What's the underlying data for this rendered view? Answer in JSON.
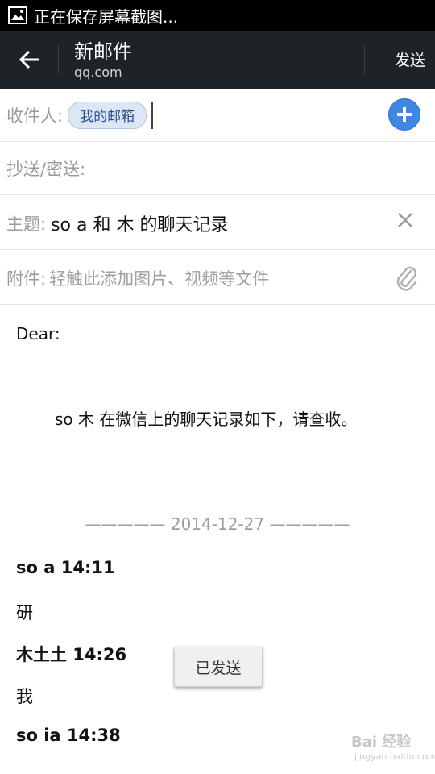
{
  "status_bar": {
    "notification_text": "正在保存屏幕截图..."
  },
  "action_bar": {
    "title": "新邮件",
    "account_email": "qq.com",
    "send_label": "发送"
  },
  "compose": {
    "to_label": "收件人:",
    "to_chip": "我的邮箱",
    "cc_label": "抄送/密送:",
    "subject_label": "主题:",
    "subject_value": "so  a 和 木 的聊天记录",
    "attachment_label": "附件:",
    "attachment_placeholder": "轻触此添加图片、视频等文件"
  },
  "body": {
    "greeting": "Dear:",
    "intro": "so  木 在微信上的聊天记录如下，请查收。",
    "divider": "—————  2014-12-27  —————",
    "messages": [
      {
        "header": "so  a 14:11",
        "text": "研"
      },
      {
        "header": "木土土 14:26",
        "text": "我"
      },
      {
        "header": "so  ia 14:38",
        "text": ""
      }
    ]
  },
  "toast": {
    "text": "已发送"
  },
  "watermark": {
    "brand": "Bai 经验",
    "url": "jingyan.baidu.com"
  }
}
